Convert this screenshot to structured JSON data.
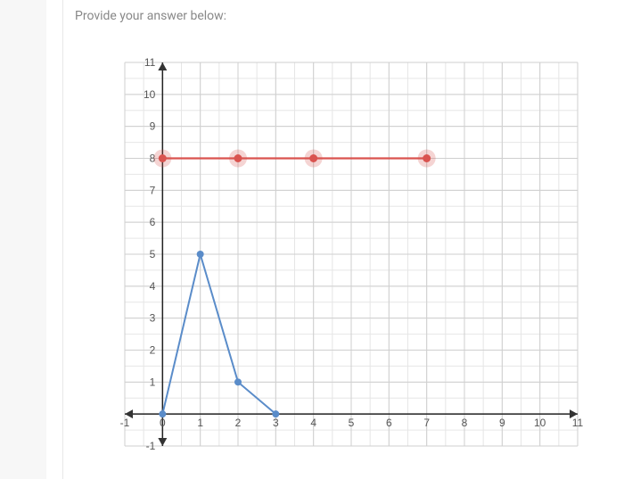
{
  "prompt": "Provide your answer below:",
  "chart_data": {
    "type": "line",
    "title": "",
    "xlabel": "",
    "ylabel": "",
    "xlim": [
      -1,
      11
    ],
    "ylim": [
      -1,
      11
    ],
    "x_ticks": [
      -1,
      0,
      1,
      2,
      3,
      4,
      5,
      6,
      7,
      8,
      9,
      10,
      11
    ],
    "y_ticks": [
      -1,
      1,
      2,
      3,
      4,
      5,
      6,
      7,
      8,
      9,
      10,
      11
    ],
    "minor_grid_step": 0.5,
    "major_grid_step": 1,
    "series": [
      {
        "name": "red-line",
        "color": "#d9534f",
        "draggable": true,
        "x": [
          0,
          2,
          4,
          7
        ],
        "y": [
          8,
          8,
          8,
          8
        ]
      },
      {
        "name": "blue-line",
        "color": "#5a8cc9",
        "draggable": false,
        "x": [
          0,
          1,
          2,
          3
        ],
        "y": [
          0,
          5,
          1,
          0
        ]
      }
    ]
  }
}
